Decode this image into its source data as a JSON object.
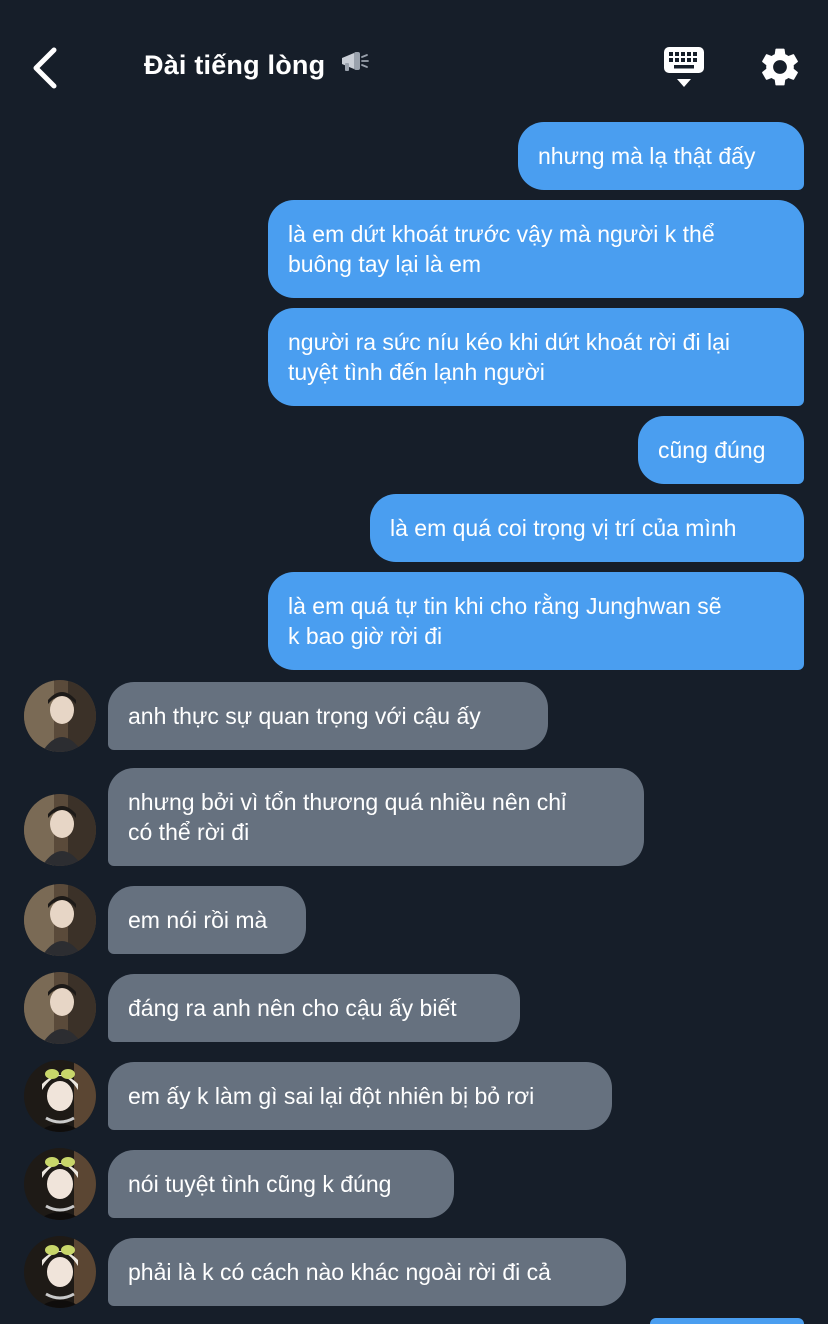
{
  "header": {
    "title": "Đài tiếng lòng",
    "back_icon": "chevron-left-icon",
    "title_icon": "megaphone-icon",
    "keyboard_icon": "keyboard-icon",
    "settings_icon": "gear-icon"
  },
  "colors": {
    "background": "#161e29",
    "outgoing_bubble": "#4a9ef0",
    "incoming_bubble": "#66717f",
    "text": "#ffffff"
  },
  "messages": [
    {
      "direction": "outgoing",
      "text": "nhưng mà lạ thật đấy"
    },
    {
      "direction": "outgoing",
      "text": "là em dứt khoát trước vậy mà người k thể\nbuông tay lại là em"
    },
    {
      "direction": "outgoing",
      "text": "người ra sức níu kéo khi dứt khoát rời đi lại\ntuyệt tình đến lạnh người"
    },
    {
      "direction": "outgoing",
      "text": "cũng đúng"
    },
    {
      "direction": "outgoing",
      "text": "là em quá coi trọng vị trí của mình"
    },
    {
      "direction": "outgoing",
      "text": "là em quá tự tin khi cho rằng Junghwan sẽ\nk bao giờ rời đi"
    },
    {
      "direction": "incoming",
      "sender": "avatar-a",
      "text": "anh thực sự quan trọng với cậu ấy"
    },
    {
      "direction": "incoming",
      "sender": "avatar-a",
      "text": "nhưng bởi vì tổn thương quá nhiều nên chỉ\ncó thể rời đi"
    },
    {
      "direction": "incoming",
      "sender": "avatar-a",
      "text": "em nói rồi mà"
    },
    {
      "direction": "incoming",
      "sender": "avatar-a",
      "text": "đáng ra anh nên cho cậu ấy biết"
    },
    {
      "direction": "incoming",
      "sender": "avatar-b",
      "text": "em ấy k làm gì sai lại đột nhiên bị bỏ rơi"
    },
    {
      "direction": "incoming",
      "sender": "avatar-b",
      "text": "nói tuyệt tình cũng k đúng"
    },
    {
      "direction": "incoming",
      "sender": "avatar-b",
      "text": "phải là k có cách nào khác ngoài rời đi cả"
    }
  ]
}
